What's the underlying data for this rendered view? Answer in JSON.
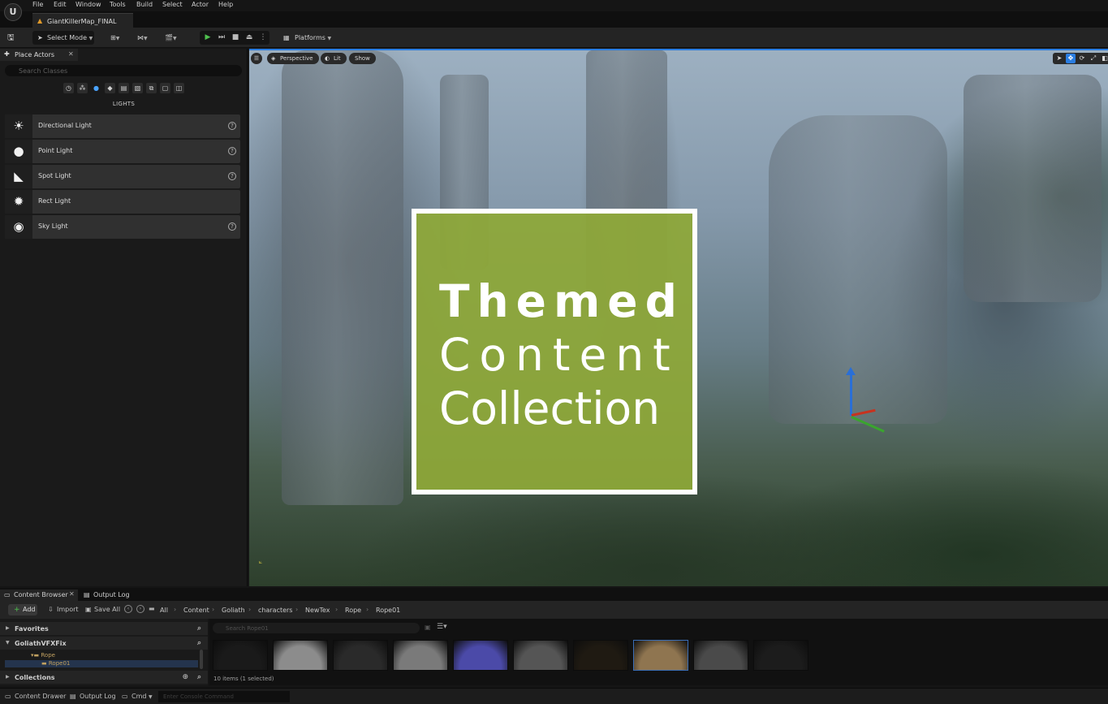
{
  "app": {
    "logo": "U",
    "document_tab": "GiantKillerMap_FINAL"
  },
  "menu": [
    "File",
    "Edit",
    "Window",
    "Tools",
    "Build",
    "Select",
    "Actor",
    "Help"
  ],
  "toolbar": {
    "select_mode": "Select Mode",
    "platforms": "Platforms"
  },
  "place_actors": {
    "tab_label": "Place Actors",
    "search_placeholder": "Search Classes",
    "section_title": "LIGHTS",
    "items": [
      {
        "label": "Directional Light",
        "icon": "sun-icon",
        "help": true
      },
      {
        "label": "Point Light",
        "icon": "bulb-icon",
        "help": true
      },
      {
        "label": "Spot Light",
        "icon": "spotlight-icon",
        "help": true
      },
      {
        "label": "Rect Light",
        "icon": "rect-light-icon",
        "help": false
      },
      {
        "label": "Sky Light",
        "icon": "sky-light-icon",
        "help": true
      }
    ]
  },
  "viewport": {
    "perspective": "Perspective",
    "lit": "Lit",
    "show": "Show",
    "accent": "#2a7de1"
  },
  "overlay": {
    "line1": "Themed",
    "line2": "Content",
    "line3": "Collection",
    "background": "#8ea838"
  },
  "content_browser": {
    "tab_content": "Content Browser",
    "tab_output": "Output Log",
    "add": "Add",
    "import": "Import",
    "save_all": "Save All",
    "breadcrumbs": [
      "All",
      "Content",
      "Goliath",
      "characters",
      "NewTex",
      "Rope",
      "Rope01"
    ],
    "favorites": "Favorites",
    "project": "GoliathVFXFix",
    "tree_rope": "Rope",
    "tree_rope01": "Rope01",
    "collections": "Collections",
    "search_placeholder": "Search Rope01",
    "item_count": "10 items (1 selected)",
    "tiles": [
      {
        "color": "#1a1a1a"
      },
      {
        "color": "#8c8c8c"
      },
      {
        "color": "#2a2a2a"
      },
      {
        "color": "#7a7a7a"
      },
      {
        "color": "#4b4aa8"
      },
      {
        "color": "#555555"
      },
      {
        "color": "#1f1a12"
      },
      {
        "color": "#8f7550"
      },
      {
        "color": "#4a4a4a"
      },
      {
        "color": "#1c1c1c"
      }
    ]
  },
  "status_bar": {
    "content_drawer": "Content Drawer",
    "output_log": "Output Log",
    "cmd": "Cmd",
    "cmd_placeholder": "Enter Console Command"
  }
}
